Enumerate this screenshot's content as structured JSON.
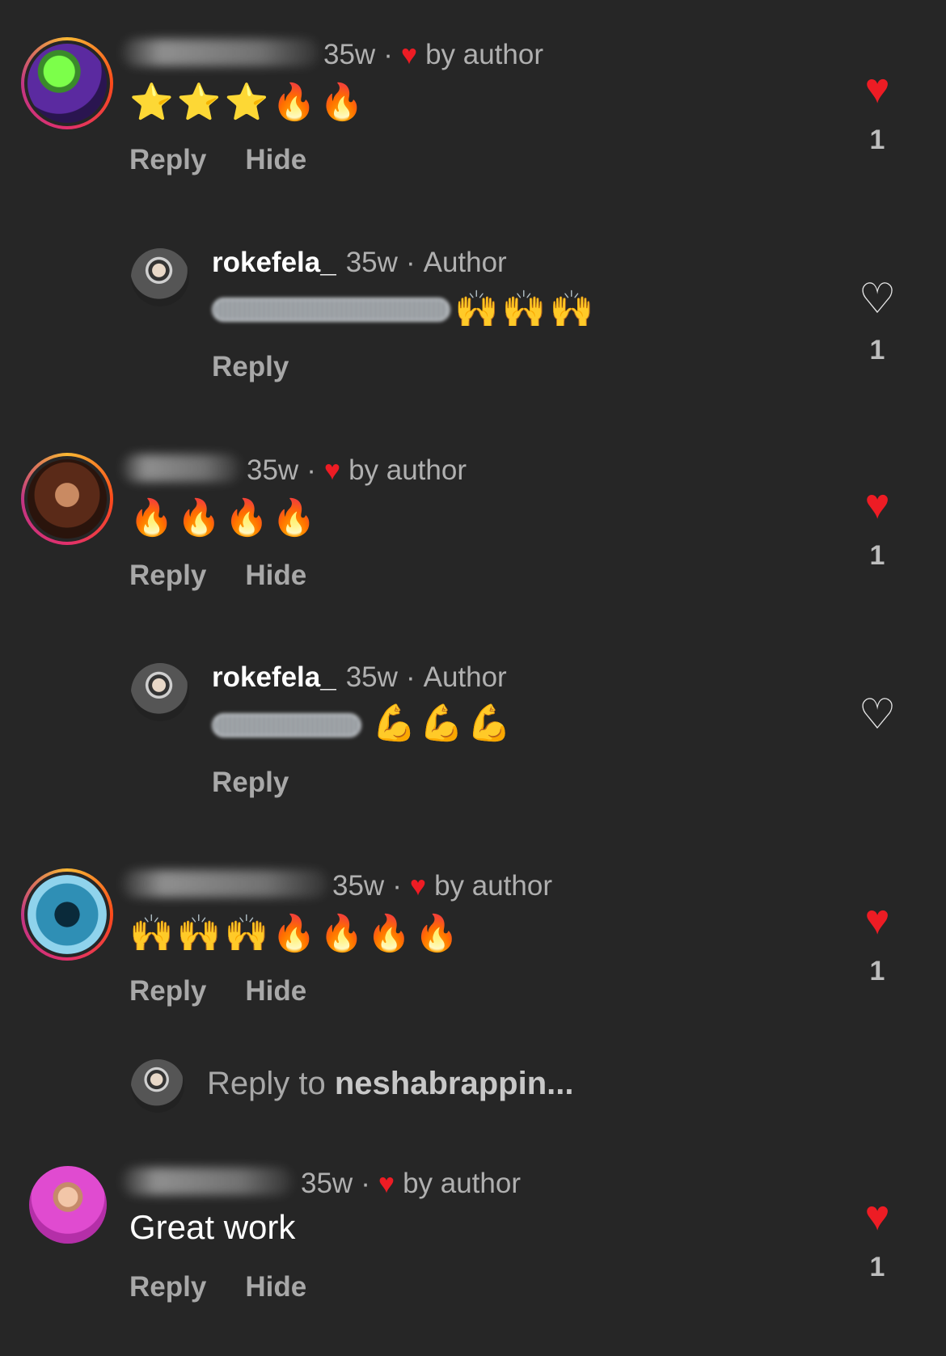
{
  "comments": [
    {
      "time": "35w",
      "liked_label": "by author",
      "content": "⭐⭐⭐🔥🔥",
      "reply": "Reply",
      "hide": "Hide",
      "likes": "1"
    },
    {
      "username": "rokefela_",
      "time": "35w",
      "role": "Author",
      "content": "🙌🙌🙌",
      "reply": "Reply",
      "likes": "1"
    },
    {
      "time": "35w",
      "liked_label": "by author",
      "content": "🔥🔥🔥🔥",
      "reply": "Reply",
      "hide": "Hide",
      "likes": "1"
    },
    {
      "username": "rokefela_",
      "time": "35w",
      "role": "Author",
      "content": "💪💪💪",
      "reply": "Reply"
    },
    {
      "time": "35w",
      "liked_label": "by author",
      "content": "🙌🙌🙌🔥🔥🔥🔥",
      "reply": "Reply",
      "hide": "Hide",
      "likes": "1"
    },
    {
      "time": "35w",
      "liked_label": "by author",
      "content": "Great work",
      "reply": "Reply",
      "hide": "Hide",
      "likes": "1"
    }
  ],
  "reply_box": {
    "prefix": "Reply to ",
    "target": "neshabrappin..."
  },
  "icons": {
    "liked_heart": "filled-red-heart",
    "unliked_heart": "outline-heart"
  },
  "colors": {
    "background": "#262626",
    "heart_red": "#ed1c24"
  }
}
